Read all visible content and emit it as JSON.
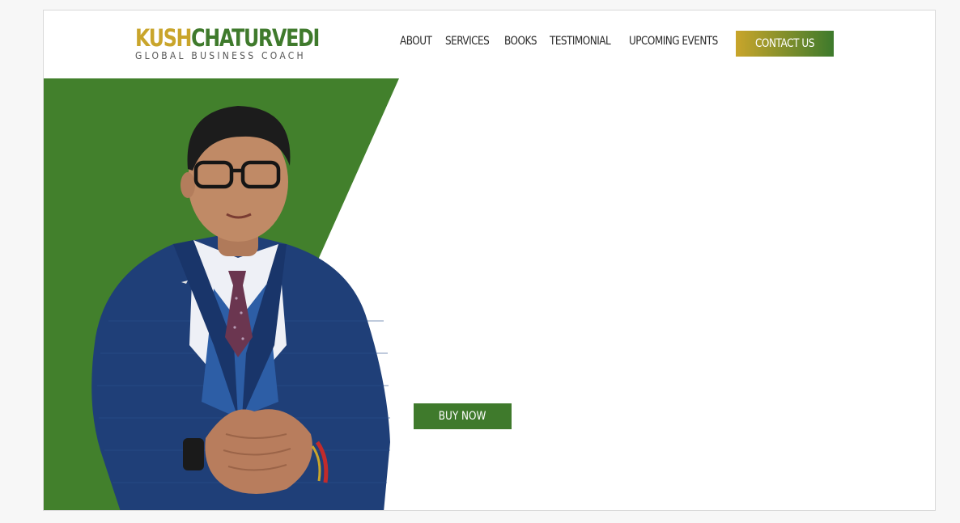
{
  "brand": {
    "first_name": "KUSH",
    "last_name": "CHATURVEDI",
    "tagline": "GLOBAL BUSINESS COACH"
  },
  "nav": {
    "items": [
      {
        "label": "ABOUT"
      },
      {
        "label": "SERVICES"
      },
      {
        "label": "BOOKS"
      },
      {
        "label": "TESTIMONIAL"
      },
      {
        "label": "UPCOMING EVENTS"
      }
    ],
    "contact_label": "CONTACT US"
  },
  "hero": {
    "photo_icon": "portrait-photo",
    "buy_label": "BUY NOW"
  },
  "colors": {
    "brand_gold": "#c9a52b",
    "brand_green": "#3f7a2c",
    "suit_navy": "#1f3f78"
  }
}
